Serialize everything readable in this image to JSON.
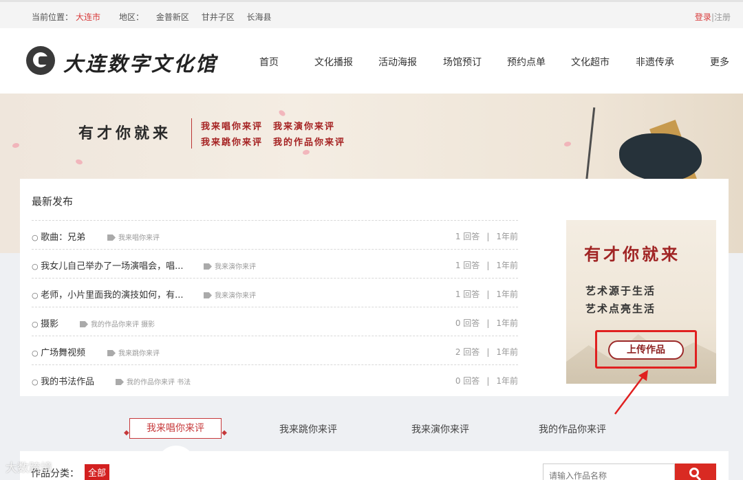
{
  "topbar": {
    "location_label": "当前位置：",
    "city": "大连市",
    "area_label": "地区：",
    "areas": [
      "金普新区",
      "甘井子区",
      "长海县"
    ],
    "login": "登录",
    "sep": "|",
    "register": "注册"
  },
  "header": {
    "logo_text": "大连数字文化馆",
    "nav": [
      "首页",
      "文化播报",
      "活动海报",
      "场馆预订",
      "预约点单",
      "文化超市",
      "非遗传承",
      "更多"
    ]
  },
  "banner": {
    "slogan": "有才你就来",
    "line1": "我来唱你来评　我来演你来评",
    "line2": "我来跳你来评　我的作品你来评"
  },
  "latest": {
    "title": "最新发布",
    "items": [
      {
        "title": "歌曲：兄弟",
        "tags": "我来唱你来评",
        "answers": "1 回答",
        "time": "1年前"
      },
      {
        "title": "我女儿自己举办了一场演唱会，唱...",
        "tags": "我来演你来评",
        "answers": "1 回答",
        "time": "1年前"
      },
      {
        "title": "老师，小片里面我的演技如何，有...",
        "tags": "我来演你来评",
        "answers": "1 回答",
        "time": "1年前"
      },
      {
        "title": "摄影",
        "tags": "我的作品你来评  摄影",
        "answers": "0 回答",
        "time": "1年前"
      },
      {
        "title": "广场舞视频",
        "tags": "我来跳你来评",
        "answers": "2 回答",
        "time": "1年前"
      },
      {
        "title": "我的书法作品",
        "tags": "我的作品你来评  书法",
        "answers": "0 回答",
        "time": "1年前"
      }
    ],
    "sep": "|"
  },
  "promo": {
    "title": "有才你就来",
    "line1": "艺术源于生活",
    "line2": "艺术点亮生活",
    "upload": "上传作品"
  },
  "tabs": [
    "我来唱你来评",
    "我来跳你来评",
    "我来演你来评",
    "我的作品你来评"
  ],
  "filter": {
    "label": "作品分类：",
    "all": "全部",
    "search_placeholder": "请输入作品名称"
  },
  "watermark": "大数跨境",
  "colors": {
    "accent": "#d32020",
    "brand_red": "#a02424"
  }
}
